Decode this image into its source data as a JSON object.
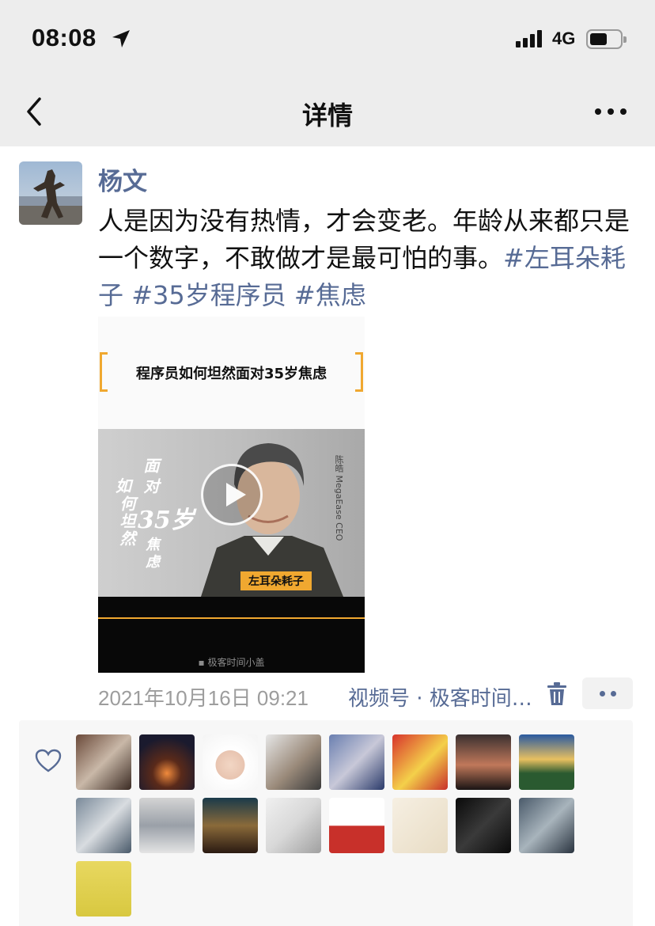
{
  "status_bar": {
    "time": "08:08",
    "network": "4G",
    "battery_level": 0.55
  },
  "nav": {
    "title": "详情",
    "back_icon": "chevron-left-icon",
    "more_icon": "more-dots-icon"
  },
  "post": {
    "author": "杨文",
    "text": "人是因为没有热情，才会变老。年龄从来都只是一个数字，不敢做才是最可怕的事。",
    "tags": [
      "#左耳朵耗子",
      "#35岁程序员",
      "#焦虑"
    ],
    "video": {
      "headline": "程序员如何坦然面对35岁焦虑",
      "calligraphy": {
        "col_right": "面对",
        "big": "35岁",
        "col_left_2": "何坦然",
        "col_left_1": "如",
        "col_bottom": "焦虑"
      },
      "speaker_name": "陈皓",
      "speaker_title": "MegaEase CEO",
      "badge": "左耳朵耗子",
      "footer": "极客时间小盖"
    },
    "date": "2021年10月16日 09:21",
    "source": "视频号 · 极客时间小盖"
  },
  "likes": {
    "heart_icon": "heart-outline-icon",
    "avatars": [
      {
        "label": "striped-shirt-person"
      },
      {
        "label": "tent-night"
      },
      {
        "label": "baby-christmas-hat"
      },
      {
        "label": "dog-and-child"
      },
      {
        "label": "cartoon-boy"
      },
      {
        "label": "duck-new-year"
      },
      {
        "label": "city-sunset"
      },
      {
        "label": "mountain-sunrise"
      },
      {
        "label": "child-in-car"
      },
      {
        "label": "tea-cup"
      },
      {
        "label": "iron-man"
      },
      {
        "label": "sleeping-cat"
      },
      {
        "label": "cartoon-hoodie"
      },
      {
        "label": "calligraphy"
      },
      {
        "label": "dark-band"
      },
      {
        "label": "cat-painting"
      },
      {
        "label": "cartoon-cap-boy"
      }
    ]
  },
  "colors": {
    "link": "#576b95",
    "accent": "#f0a830",
    "bar": "#ededed",
    "meta": "#9d9d9d"
  }
}
